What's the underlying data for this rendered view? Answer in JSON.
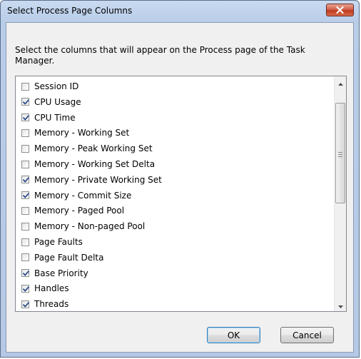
{
  "window": {
    "title": "Select Process Page Columns"
  },
  "description": "Select the columns that will appear on the Process page of the Task Manager.",
  "columns": [
    {
      "label": "Session ID",
      "checked": false
    },
    {
      "label": "CPU Usage",
      "checked": true
    },
    {
      "label": "CPU Time",
      "checked": true
    },
    {
      "label": "Memory - Working Set",
      "checked": false
    },
    {
      "label": "Memory - Peak Working Set",
      "checked": false
    },
    {
      "label": "Memory - Working Set Delta",
      "checked": false
    },
    {
      "label": "Memory - Private Working Set",
      "checked": true
    },
    {
      "label": "Memory - Commit Size",
      "checked": true
    },
    {
      "label": "Memory - Paged Pool",
      "checked": false
    },
    {
      "label": "Memory - Non-paged Pool",
      "checked": false
    },
    {
      "label": "Page Faults",
      "checked": false
    },
    {
      "label": "Page Fault Delta",
      "checked": false
    },
    {
      "label": "Base Priority",
      "checked": true
    },
    {
      "label": "Handles",
      "checked": true
    },
    {
      "label": "Threads",
      "checked": true
    }
  ],
  "buttons": {
    "ok": "OK",
    "cancel": "Cancel"
  },
  "icons": {
    "close": "close-icon",
    "scroll_up": "scroll-up-arrow-icon",
    "scroll_down": "scroll-down-arrow-icon",
    "check": "checkmark-icon"
  },
  "colors": {
    "close_button": "#c9462c",
    "checkmark": "#2b4a8a",
    "default_button_border": "#3c7fb1"
  }
}
